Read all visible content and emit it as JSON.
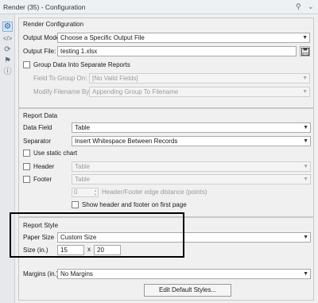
{
  "window": {
    "title": "Render (35) - Configuration"
  },
  "render_config": {
    "title": "Render Configuration",
    "output_mode_label": "Output Mode:",
    "output_mode_value": "Choose a Specific Output File",
    "output_file_label": "Output File:",
    "output_file_value": "testing 1.xlsx",
    "group_data_label": "Group Data Into Separate Reports",
    "field_group_label": "Field To Group On:",
    "field_group_value": "[No Valid Fields]",
    "modify_filename_label": "Modify Filename By:",
    "modify_filename_value": "Appending Group To Filename"
  },
  "report_data": {
    "title": "Report Data",
    "data_field_label": "Data Field",
    "data_field_value": "Table",
    "separator_label": "Separator",
    "separator_value": "Insert Whitespace Between Records",
    "static_chart_label": "Use static chart",
    "header_label": "Header",
    "header_value": "Table",
    "footer_label": "Footer",
    "footer_value": "Table",
    "edge_distance_value": "0",
    "edge_distance_label": "Header/Footer edge distance (points)",
    "show_first_page_label": "Show header and footer on first page"
  },
  "report_style": {
    "title": "Report Style",
    "paper_size_label": "Paper Size",
    "paper_size_value": "Custom Size",
    "size_label": "Size (in.)",
    "width_value": "15",
    "size_sep": "x",
    "height_value": "20",
    "margins_label": "Margins (in.)",
    "margins_value": "No Margins",
    "edit_styles_label": "Edit Default Styles..."
  },
  "icons": {
    "pin": "pin-icon",
    "close": "chevron-icon",
    "config": "gear-icon",
    "code": "code-icon",
    "annotation": "annotation-icon",
    "tag": "tag-icon",
    "help": "help-icon"
  },
  "colors": {
    "highlight": "#000000",
    "active_tab": "#cfe3f7"
  }
}
